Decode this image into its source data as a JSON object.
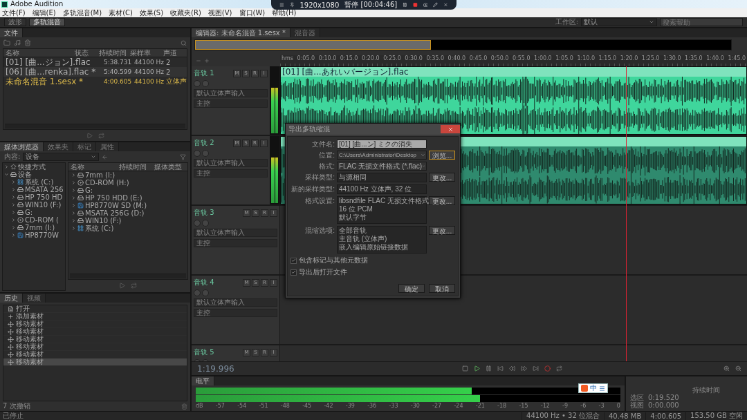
{
  "app_title": "Adobe Audition",
  "recorder": {
    "resolution": "1920x1080",
    "status": "暂停 [00:04:46]"
  },
  "menu": [
    "文件(F)",
    "编辑(E)",
    "多轨混音(M)",
    "素材(C)",
    "效果(S)",
    "收藏夹(R)",
    "视图(V)",
    "窗口(W)",
    "帮助(H)"
  ],
  "toolbar": {
    "modes": [
      {
        "label": "波形",
        "selected": false
      },
      {
        "label": "多轨混音",
        "selected": true
      }
    ],
    "workspace_label": "工作区:",
    "workspace": "默认",
    "search_placeholder": "搜索帮助"
  },
  "files_panel": {
    "tab": "文件",
    "columns": [
      "名称",
      "状态",
      "持续时间",
      "采样率",
      "声道"
    ],
    "rows": [
      {
        "name": "[01] [曲...ジョン].flac",
        "duration": "5:38.731",
        "rate": "44100 Hz",
        "channels": "2",
        "kind": "audio"
      },
      {
        "name": "[06] [曲...renka].flac *",
        "duration": "5:40.599",
        "rate": "44100 Hz",
        "channels": "2",
        "kind": "audio"
      },
      {
        "name": "未命名混音 1.sesx *",
        "duration": "4:00.605",
        "rate": "44100 Hz",
        "channels": "立体声",
        "kind": "session"
      }
    ]
  },
  "media_browser": {
    "tabs": [
      {
        "label": "媒体浏览器",
        "selected": true
      },
      {
        "label": "效果夹",
        "selected": false
      },
      {
        "label": "标记",
        "selected": false
      },
      {
        "label": "属性",
        "selected": false
      }
    ],
    "content_label": "内容:",
    "content_value": "设备",
    "tree": [
      {
        "label": "快捷方式",
        "kind": "shortcut",
        "expanded": false
      },
      {
        "label": "设备",
        "kind": "drive",
        "expanded": true,
        "children": [
          {
            "label": "系统 (C:)",
            "kind": "system"
          },
          {
            "label": "MSATA 256",
            "kind": "drive"
          },
          {
            "label": "HP 750 HD",
            "kind": "drive"
          },
          {
            "label": "WIN10 (F:)",
            "kind": "drive"
          },
          {
            "label": "G:",
            "kind": "drive"
          },
          {
            "label": "CD-ROM (",
            "kind": "cdrom"
          },
          {
            "label": "7mm (I:)",
            "kind": "drive"
          },
          {
            "label": "HP8770W",
            "kind": "sd"
          }
        ]
      }
    ],
    "columns": [
      "名称",
      "持续时间",
      "媒体类型"
    ],
    "items": [
      {
        "label": "7mm (I:)",
        "kind": "drive"
      },
      {
        "label": "CD-ROM (H:)",
        "kind": "cdrom"
      },
      {
        "label": "G:",
        "kind": "drive"
      },
      {
        "label": "HP 750 HDD (E:)",
        "kind": "drive"
      },
      {
        "label": "HP8770W SD (M:)",
        "kind": "sd"
      },
      {
        "label": "MSATA 256G (D:)",
        "kind": "drive"
      },
      {
        "label": "WIN10 (F:)",
        "kind": "drive"
      },
      {
        "label": "系统 (C:)",
        "kind": "system"
      }
    ]
  },
  "history": {
    "tabs": [
      {
        "label": "历史",
        "selected": true
      },
      {
        "label": "视频",
        "selected": false
      }
    ],
    "items": [
      {
        "label": "打开",
        "kind": "open",
        "selected": false
      },
      {
        "label": "添加素材",
        "kind": "add",
        "selected": false
      },
      {
        "label": "移动素材",
        "kind": "move",
        "selected": false
      },
      {
        "label": "移动素材",
        "kind": "move",
        "selected": false
      },
      {
        "label": "移动素材",
        "kind": "move",
        "selected": false
      },
      {
        "label": "移动素材",
        "kind": "move",
        "selected": false
      },
      {
        "label": "移动素材",
        "kind": "move",
        "selected": false
      },
      {
        "label": "移动素材",
        "kind": "move",
        "selected": true
      }
    ],
    "undo_count": "7 次撤销"
  },
  "editor": {
    "tabs": [
      {
        "label": "编辑器: 未命名混音 1.sesx *",
        "selected": true
      },
      {
        "label": "混音器",
        "selected": false
      }
    ],
    "ruler": [
      "hms",
      "0:05.0",
      "0:10.0",
      "0:15.0",
      "0:20.0",
      "0:25.0",
      "0:30.0",
      "0:35.0",
      "0:40.0",
      "0:45.0",
      "0:50.0",
      "0:55.0",
      "1:00.0",
      "1:05.0",
      "1:10.0",
      "1:15.0",
      "1:20.0",
      "1:25.0",
      "1:30.0",
      "1:35.0",
      "1:40.0",
      "1:45.0"
    ],
    "tracks": [
      {
        "name": "音轨 1",
        "buttons": [
          "M",
          "S",
          "R",
          "I"
        ],
        "input": "默认立体声输入",
        "output": "主控",
        "has_clip": true,
        "clip_title": "[01] [曲...あれいバージョン].flac",
        "color": "#3fd69c"
      },
      {
        "name": "音轨 2",
        "buttons": [
          "M",
          "S",
          "R",
          "I"
        ],
        "input": "默认立体声输入",
        "output": "主控",
        "has_clip": true,
        "color": "#2f8a6e"
      },
      {
        "name": "音轨 3",
        "buttons": [
          "M",
          "S",
          "R",
          "I"
        ],
        "input": "默认立体声输入",
        "output": "主控",
        "has_clip": false
      },
      {
        "name": "音轨 4",
        "buttons": [
          "M",
          "S",
          "R",
          "I"
        ],
        "input": "默认立体声输入",
        "output": "主控",
        "has_clip": false
      },
      {
        "name": "音轨 5",
        "buttons": [
          "M",
          "S",
          "R",
          "I"
        ],
        "has_clip": false
      }
    ],
    "time": "1:19.996"
  },
  "meter": {
    "title": "电平",
    "channels": [
      {
        "level": 0.65
      },
      {
        "level": 0.67
      }
    ],
    "scale": [
      "dB",
      "-57",
      "-54",
      "-51",
      "-48",
      "-45",
      "-42",
      "-39",
      "-36",
      "-33",
      "-30",
      "-27",
      "-24",
      "-21",
      "-18",
      "-15",
      "-12",
      "-9",
      "-6",
      "-3",
      "0"
    ]
  },
  "selection_panel": {
    "header": "持续时间",
    "rows": [
      {
        "label": "选区",
        "value": "0:19.520"
      },
      {
        "label": "视图",
        "value": "0:00.000"
      }
    ]
  },
  "ime": {
    "label": "中"
  },
  "dialog": {
    "title": "导出多轨缩混",
    "filename_label": "文件名:",
    "filename": "[01] [曲...ン] ミクの消失",
    "location_label": "位置:",
    "location": "C:\\Users\\Administrator\\Desktop",
    "browse": "浏览...",
    "format_label": "格式:",
    "format": "FLAC 无损文件格式 (*.flac)",
    "sample_label": "采样类型:",
    "sample": "与源相同",
    "sample_change": "更改...",
    "new_sample_label": "新的采样类型:",
    "new_sample": "44100 Hz 立体声, 32 位",
    "format_settings_label": "格式设置:",
    "format_settings": [
      "libsndfile FLAC 无损文件格式",
      "16 位 PCM",
      "默认字节"
    ],
    "format_change": "更改...",
    "mix_label": "混缩选项:",
    "mix_options": [
      "全部音轨",
      "主音轨 (立体声)",
      "嵌入编辑原始链接数据"
    ],
    "mix_change": "更改...",
    "checks": [
      {
        "label": "包含标记与其他元数据",
        "checked": true
      },
      {
        "label": "导出后打开文件",
        "checked": true
      }
    ],
    "ok": "确定",
    "cancel": "取消"
  },
  "status_bar": {
    "left": "已停止",
    "items": [
      "44100 Hz • 32 位混合",
      "40.48 MB",
      "4:00.605",
      "153.50 GB 空闲"
    ]
  }
}
